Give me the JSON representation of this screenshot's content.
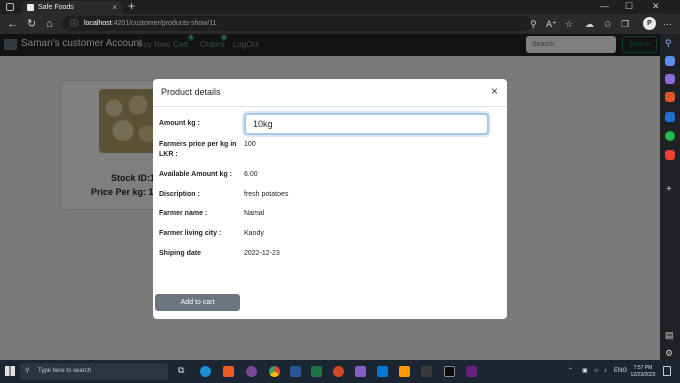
{
  "browser": {
    "tab_title": "Safe Foods",
    "tab_close": "×",
    "new_tab": "+",
    "url_host": "localhost",
    "url_path": ":4201/customer/products-show/11",
    "profile_letter": "P"
  },
  "app": {
    "brand": "Saman's customer Account",
    "nav": {
      "buy_now": "Buy Now",
      "cart": "Cart",
      "cart_badge": "0",
      "orders": "Orders",
      "orders_badge": "0",
      "logout": "LogOut"
    },
    "search_placeholder": "Search",
    "search_button": "Search",
    "card": {
      "stock": "Stock ID:12",
      "price": "Price Per kg: 18"
    }
  },
  "modal": {
    "title": "Product details",
    "close": "×",
    "amount_label": "Amount kg :",
    "amount_value": "10kg",
    "fields": [
      {
        "label": "Farmers price per kg in LKR :",
        "value": "100"
      },
      {
        "label": "Available Amount kg :",
        "value": "6.00"
      },
      {
        "label": "Discription :",
        "value": "fresh potatoes"
      },
      {
        "label": "Farmer name :",
        "value": "Namal"
      },
      {
        "label": "Farmer living city :",
        "value": "Kandy"
      },
      {
        "label": "Shiping date",
        "value": "2022-12-23"
      }
    ],
    "add_to_cart": "Add to cart"
  },
  "taskbar": {
    "search_placeholder": "Type here to search",
    "language": "ENG",
    "time": "7:57 PM",
    "date": "12/23/2022"
  },
  "colors": {
    "navbar": "#212529",
    "badge": "#198754",
    "cart_button": "#6c757d",
    "input_focus": "#a7c7e7"
  }
}
